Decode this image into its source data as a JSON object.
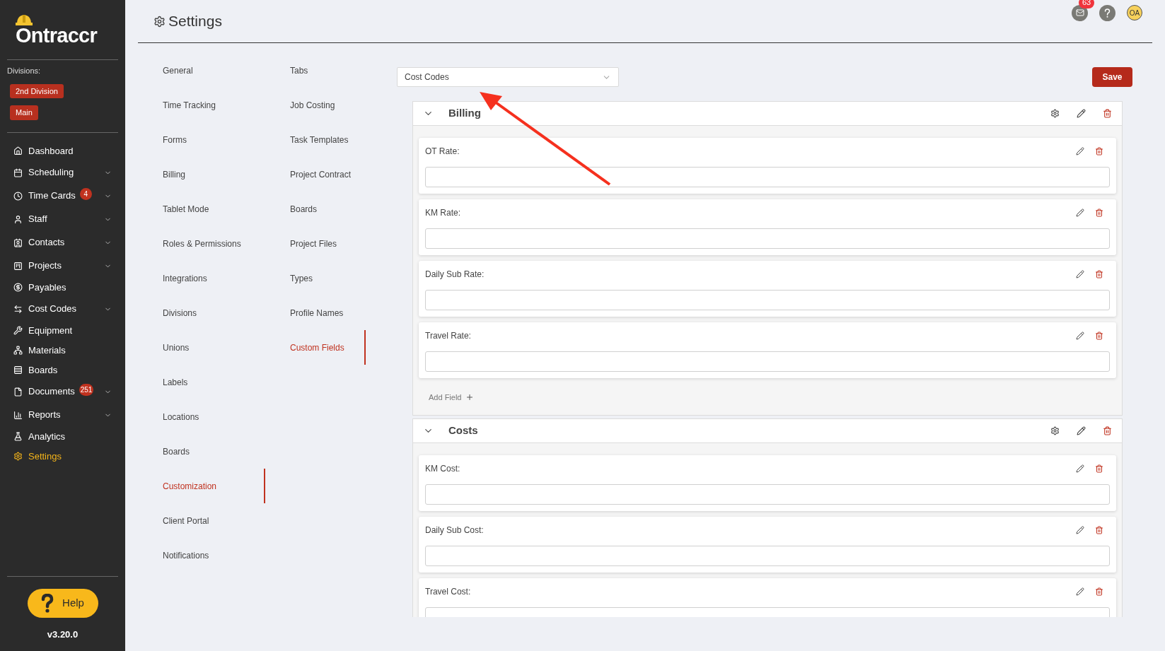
{
  "brand": {
    "name": "Ontraccr"
  },
  "divisions": {
    "label": "Divisions:",
    "items": [
      "2nd Division",
      "Main"
    ]
  },
  "sidebar": {
    "items": [
      {
        "label": "Dashboard",
        "expandable": false,
        "selected": false
      },
      {
        "label": "Scheduling",
        "expandable": true,
        "selected": false
      },
      {
        "label": "Time Cards",
        "badge": "4",
        "expandable": true,
        "selected": false
      },
      {
        "label": "Staff",
        "expandable": true,
        "selected": false
      },
      {
        "label": "Contacts",
        "expandable": true,
        "selected": false
      },
      {
        "label": "Projects",
        "expandable": true,
        "selected": false
      },
      {
        "label": "Payables",
        "expandable": false,
        "selected": false
      },
      {
        "label": "Cost Codes",
        "expandable": true,
        "selected": false
      },
      {
        "label": "Equipment",
        "expandable": false,
        "selected": false
      },
      {
        "label": "Materials",
        "expandable": false,
        "selected": false
      },
      {
        "label": "Boards",
        "expandable": false,
        "selected": false
      },
      {
        "label": "Documents",
        "badge": "251",
        "expandable": true,
        "selected": false
      },
      {
        "label": "Reports",
        "expandable": true,
        "selected": false
      },
      {
        "label": "Analytics",
        "expandable": false,
        "selected": false
      },
      {
        "label": "Settings",
        "expandable": false,
        "selected": true
      }
    ]
  },
  "help": {
    "label": "Help",
    "version": "v3.20.0"
  },
  "header": {
    "title": "Settings",
    "mail_badge": "63",
    "avatar": "OA"
  },
  "settings_nav": [
    [
      {
        "label": "General",
        "selected": false
      },
      {
        "label": "Time Tracking",
        "selected": false
      },
      {
        "label": "Forms",
        "selected": false
      },
      {
        "label": "Billing",
        "selected": false
      },
      {
        "label": "Tablet Mode",
        "selected": false
      },
      {
        "label": "Roles & Permissions",
        "selected": false
      },
      {
        "label": "Integrations",
        "selected": false
      },
      {
        "label": "Divisions",
        "selected": false
      },
      {
        "label": "Unions",
        "selected": false
      },
      {
        "label": "Labels",
        "selected": false
      },
      {
        "label": "Locations",
        "selected": false
      },
      {
        "label": "Boards",
        "selected": false
      },
      {
        "label": "Customization",
        "selected": true
      },
      {
        "label": "Client Portal",
        "selected": false
      },
      {
        "label": "Notifications",
        "selected": false
      }
    ],
    [
      {
        "label": "Tabs",
        "selected": false
      },
      {
        "label": "Job Costing",
        "selected": false
      },
      {
        "label": "Task Templates",
        "selected": false
      },
      {
        "label": "Project Contract",
        "selected": false
      },
      {
        "label": "Boards",
        "selected": false
      },
      {
        "label": "Project Files",
        "selected": false
      },
      {
        "label": "Types",
        "selected": false
      },
      {
        "label": "Profile Names",
        "selected": false
      },
      {
        "label": "Custom Fields",
        "selected": true
      }
    ]
  ],
  "dropdown": {
    "value": "Cost Codes"
  },
  "save_button": "Save",
  "sections": [
    {
      "title": "Billing",
      "expanded": true,
      "fields": [
        "OT Rate:",
        "KM Rate:",
        "Daily Sub Rate:",
        "Travel Rate:"
      ],
      "add_field": "Add Field"
    },
    {
      "title": "Costs",
      "expanded": true,
      "fields": [
        "KM Cost:",
        "Daily Sub Cost:",
        "Travel Cost:"
      ]
    }
  ]
}
